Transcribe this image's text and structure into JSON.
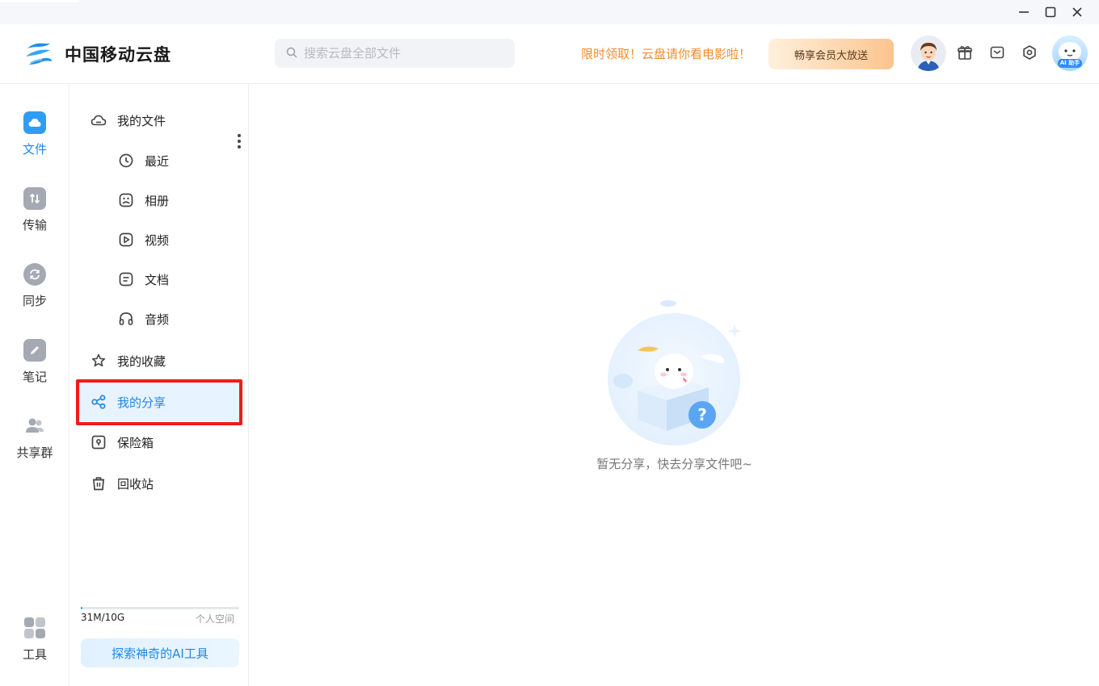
{
  "window": {
    "controls": [
      "minimize",
      "maximize",
      "close"
    ]
  },
  "header": {
    "app_title": "中国移动云盘",
    "search_placeholder": "搜索云盘全部文件",
    "promo_text": "限时领取！云盘请你看电影啦！",
    "vip_button": "畅享会员大放送",
    "ai_badge": "AI 助手",
    "icons": [
      "gift-icon",
      "mail-icon",
      "settings-icon"
    ]
  },
  "left_nav": {
    "items": [
      {
        "label": "文件",
        "icon": "cloud-icon",
        "active": true
      },
      {
        "label": "传输",
        "icon": "transfer-icon",
        "active": false
      },
      {
        "label": "同步",
        "icon": "sync-icon",
        "active": false
      },
      {
        "label": "笔记",
        "icon": "pencil-icon",
        "active": false
      },
      {
        "label": "共享群",
        "icon": "people-icon",
        "active": false
      }
    ],
    "tools": {
      "label": "工具",
      "icon": "grid-icon"
    }
  },
  "sidebar": {
    "my_files": "我的文件",
    "sub_items": [
      {
        "label": "最近",
        "icon": "clock-icon"
      },
      {
        "label": "相册",
        "icon": "album-icon"
      },
      {
        "label": "视频",
        "icon": "video-icon"
      },
      {
        "label": "文档",
        "icon": "document-icon"
      },
      {
        "label": "音频",
        "icon": "headphones-icon"
      }
    ],
    "favorites": "我的收藏",
    "shares": "我的分享",
    "vault": "保险箱",
    "recycle": "回收站",
    "active_item": "我的分享",
    "storage": {
      "used_text": "31M/10G",
      "type_label": "个人空间",
      "used_fraction": 0.003
    },
    "ai_tools_button": "探索神奇的AI工具"
  },
  "main": {
    "empty_message": "暂无分享，快去分享文件吧~"
  },
  "colors": {
    "accent": "#1f87e8",
    "promo": "#f08c2c",
    "highlight_box": "#ee1c1c"
  }
}
